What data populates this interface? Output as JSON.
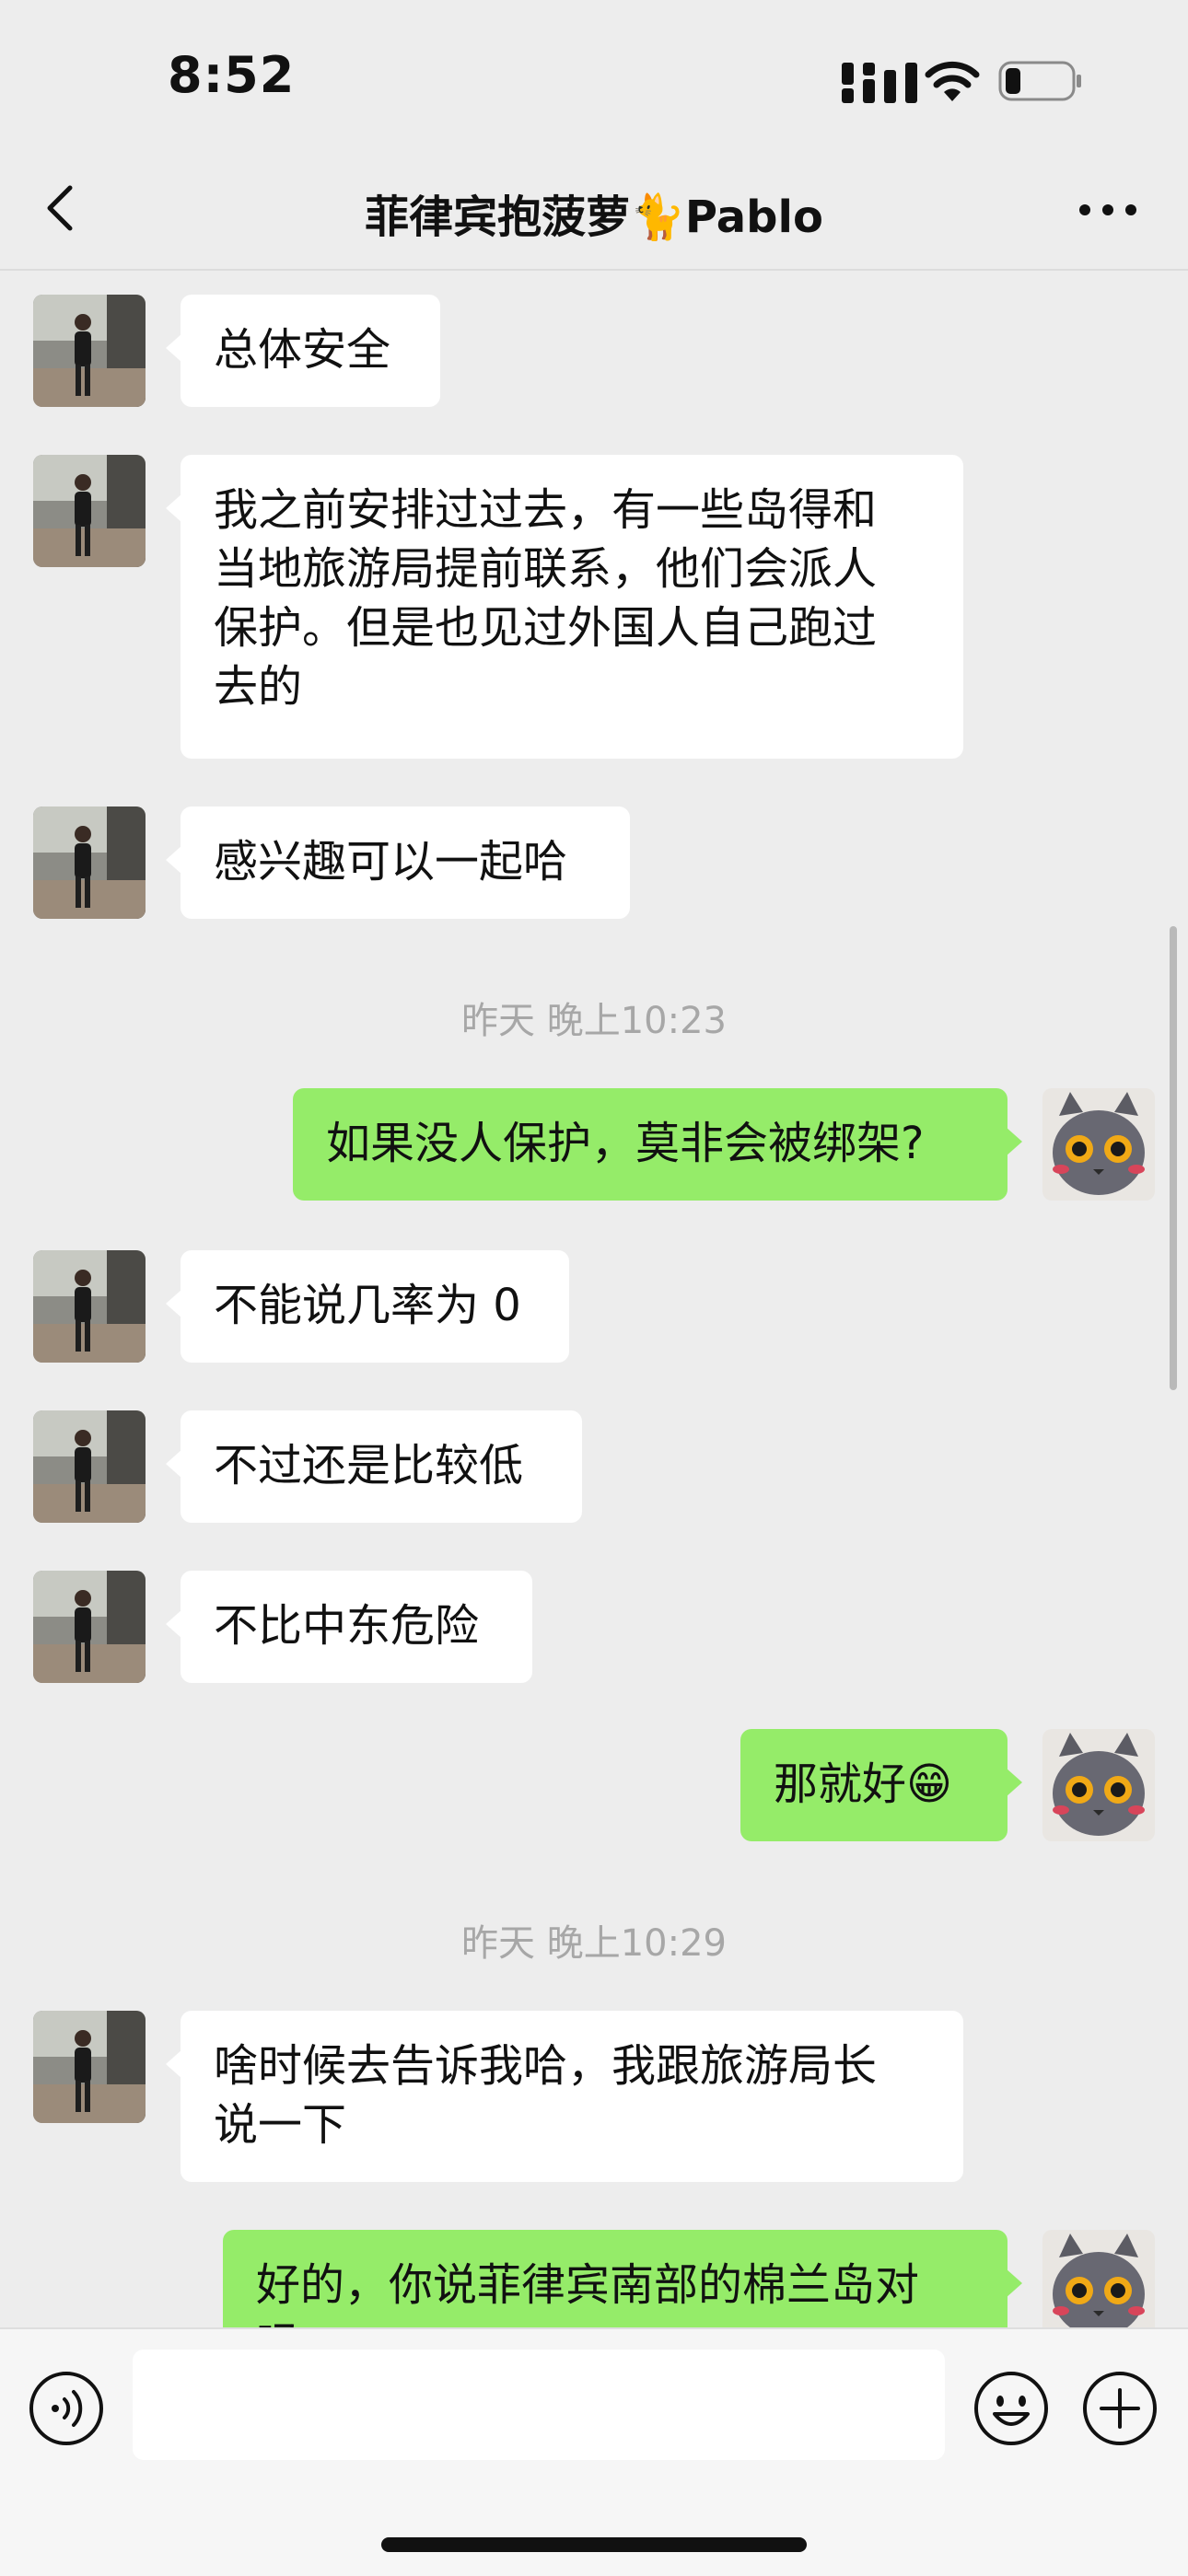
{
  "status_bar": {
    "time": "8:52"
  },
  "chat": {
    "title": "菲律宾抱菠萝🐈Pablo"
  },
  "messages": [
    {
      "side": "left",
      "text": "总体安全"
    },
    {
      "side": "left",
      "lines": [
        "我之前安排过过去，有一些岛得和",
        "当地旅游局提前联系，他们会派人",
        "保护。但是也见过外国人自己跑过",
        "去的"
      ]
    },
    {
      "side": "left",
      "text": "感兴趣可以一起哈"
    },
    {
      "timestamp": "昨天 晚上10:23"
    },
    {
      "side": "right",
      "text": "如果没人保护，莫非会被绑架?"
    },
    {
      "side": "left",
      "text": "不能说几率为 0"
    },
    {
      "side": "left",
      "text": "不过还是比较低"
    },
    {
      "side": "left",
      "text": "不比中东危险"
    },
    {
      "side": "right",
      "text": "那就好😁"
    },
    {
      "timestamp": "昨天 晚上10:29"
    },
    {
      "side": "left",
      "lines": [
        "啥时候去告诉我哈，我跟旅游局长",
        "说一下"
      ]
    },
    {
      "side": "right",
      "lines": [
        "好的，你说菲律宾南部的棉兰岛对",
        "吗"
      ]
    }
  ],
  "input": {
    "placeholder": ""
  },
  "colors": {
    "background": "#ededed",
    "self_bubble": "#95ec69",
    "other_bubble": "#ffffff",
    "timestamp": "#a7a7a7"
  }
}
